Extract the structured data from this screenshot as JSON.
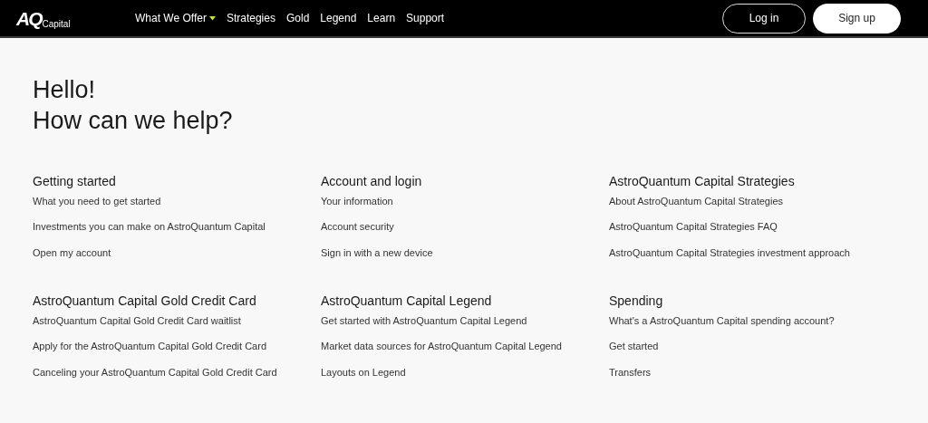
{
  "header": {
    "logo": {
      "mark": "AQ",
      "text": "Capital"
    },
    "nav": [
      {
        "label": "What We Offer",
        "kind": "dropdown"
      },
      {
        "label": "Strategies",
        "kind": "link"
      },
      {
        "label": "Gold",
        "kind": "link"
      },
      {
        "label": "Legend",
        "kind": "link"
      },
      {
        "label": "Learn",
        "kind": "link"
      },
      {
        "label": "Support",
        "kind": "link"
      }
    ],
    "buttons": [
      {
        "label": "Log in",
        "kind": "outline"
      },
      {
        "label": "Sign up",
        "kind": "filled"
      }
    ]
  },
  "greeting": [
    "Hello!",
    "How can we help?"
  ],
  "sections": [
    {
      "title": "Getting started",
      "links": [
        "What you need to get started",
        "Investments you can make on AstroQuantum Capital",
        "Open my account"
      ]
    },
    {
      "title": "Account and login",
      "links": [
        "Your information",
        "Account security",
        "Sign in with a new device"
      ]
    },
    {
      "title": "AstroQuantum Capital Strategies",
      "links": [
        "About AstroQuantum Capital Strategies",
        "AstroQuantum Capital Strategies FAQ",
        "AstroQuantum Capital Strategies investment approach"
      ]
    },
    {
      "title": "AstroQuantum Capital Gold Credit Card",
      "links": [
        "AstroQuantum Capital Gold Credit Card waitlist",
        "Apply for the AstroQuantum Capital Gold Credit Card",
        "Canceling your AstroQuantum Capital Gold Credit Card"
      ]
    },
    {
      "title": "AstroQuantum Capital Legend",
      "links": [
        "Get started with AstroQuantum Capital Legend",
        "Market data sources for AstroQuantum Capital Legend",
        "Layouts on Legend"
      ]
    },
    {
      "title": "Spending",
      "links": [
        "What's a AstroQuantum Capital spending account?",
        "Get started",
        "Transfers"
      ]
    }
  ]
}
